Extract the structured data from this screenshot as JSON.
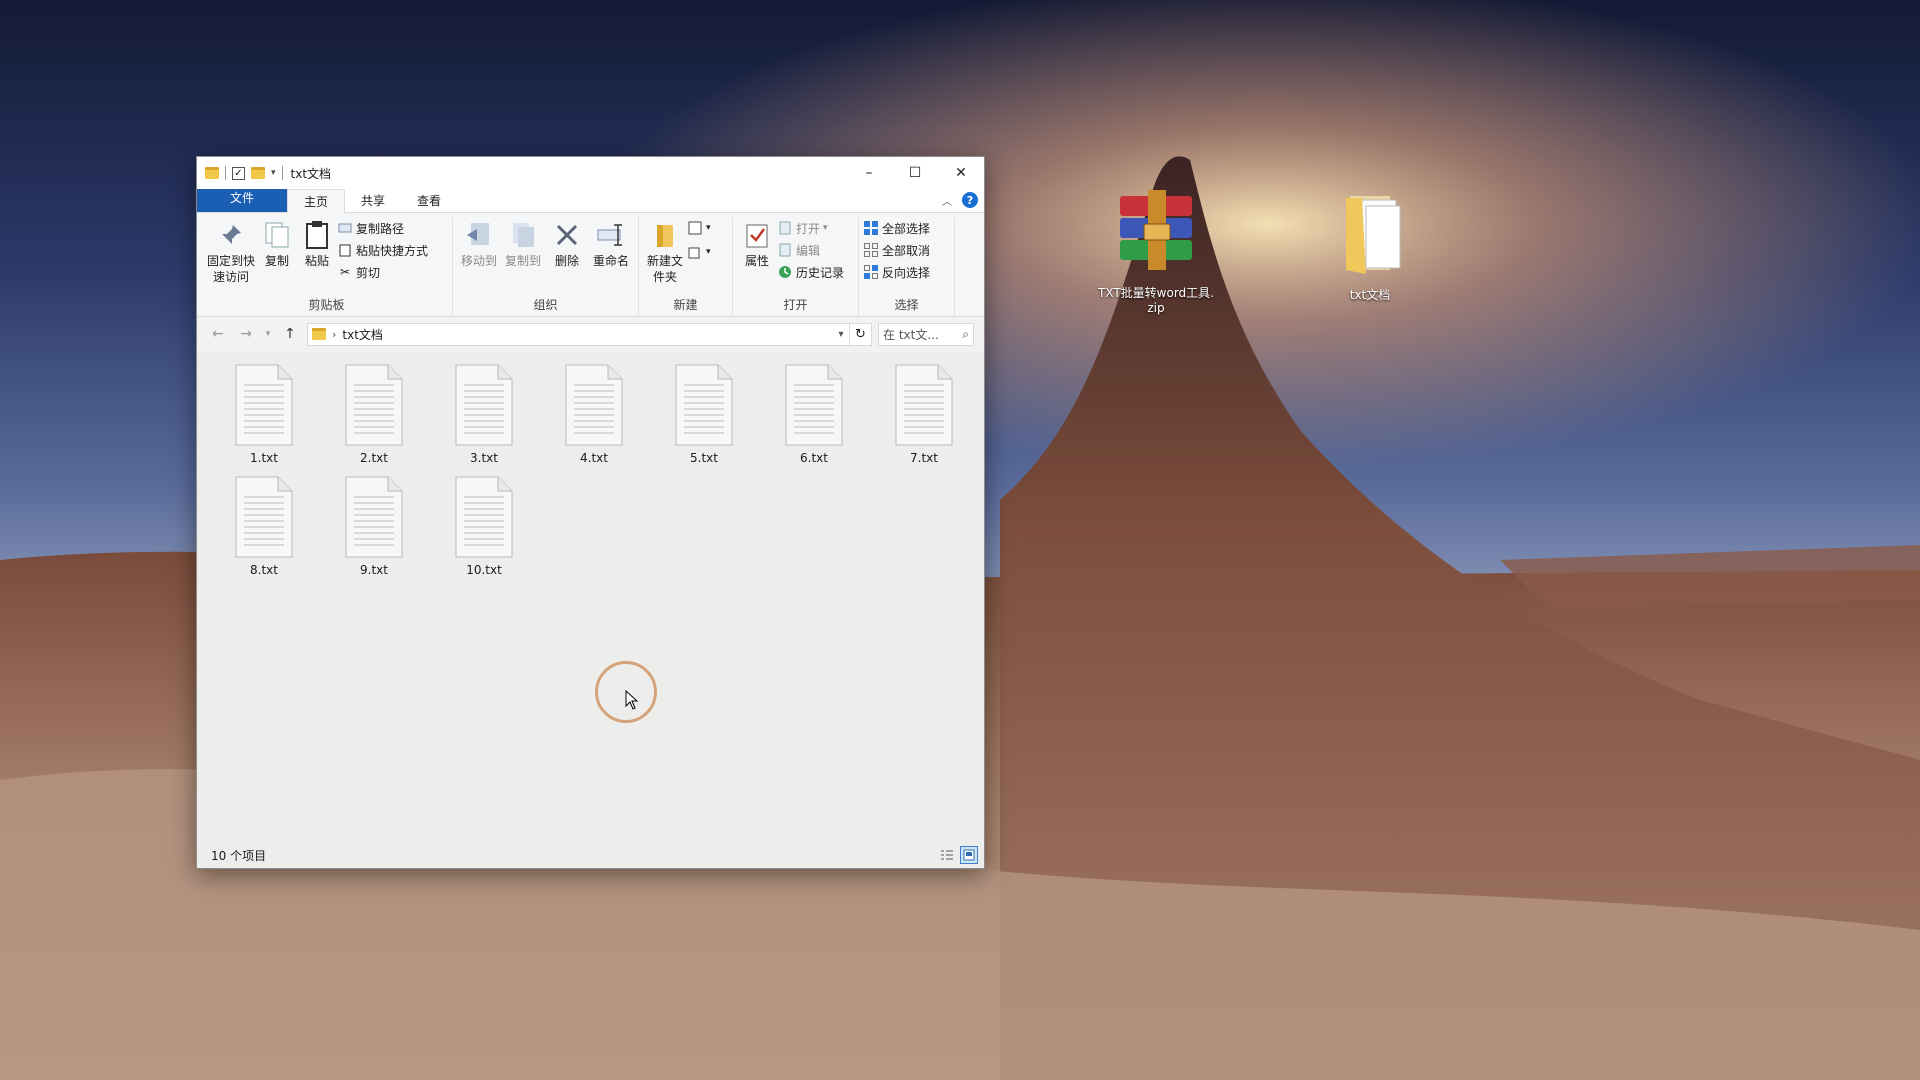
{
  "window": {
    "title": "txt文档",
    "controls": {
      "minimize": "–",
      "maximize": "☐",
      "close": "✕"
    }
  },
  "ribbon": {
    "tabs": [
      {
        "label": "文件"
      },
      {
        "label": "主页"
      },
      {
        "label": "共享"
      },
      {
        "label": "查看"
      }
    ],
    "clipboard": {
      "pin_label": "固定到快速访问",
      "copy_label": "复制",
      "paste_label": "粘贴",
      "copy_path_label": "复制路径",
      "paste_shortcut_label": "粘贴快捷方式",
      "cut_label": "剪切",
      "group_label": "剪贴板"
    },
    "organize": {
      "move_to_label": "移动到",
      "copy_to_label": "复制到",
      "delete_label": "删除",
      "rename_label": "重命名",
      "group_label": "组织"
    },
    "new": {
      "new_folder_label": "新建文件夹",
      "group_label": "新建"
    },
    "open": {
      "properties_label": "属性",
      "open_label": "打开",
      "edit_label": "编辑",
      "history_label": "历史记录",
      "group_label": "打开"
    },
    "select": {
      "select_all_label": "全部选择",
      "select_none_label": "全部取消",
      "invert_label": "反向选择",
      "group_label": "选择"
    }
  },
  "address": {
    "path": "txt文档",
    "search_placeholder": "在 txt文..."
  },
  "files": [
    {
      "name": "1.txt"
    },
    {
      "name": "2.txt"
    },
    {
      "name": "3.txt"
    },
    {
      "name": "4.txt"
    },
    {
      "name": "5.txt"
    },
    {
      "name": "6.txt"
    },
    {
      "name": "7.txt"
    },
    {
      "name": "8.txt"
    },
    {
      "name": "9.txt"
    },
    {
      "name": "10.txt"
    }
  ],
  "status": {
    "item_count": "10 个项目"
  },
  "desktop": {
    "icons": [
      {
        "label": "TXT批量转word工具.zip",
        "icon": "winrar-archive-icon"
      },
      {
        "label": "txt文档",
        "icon": "folder-icon"
      }
    ]
  },
  "colors": {
    "file_tab": "#1a5fb4",
    "help": "#1a6fd4",
    "cursor_ring": "#d5a37a"
  }
}
